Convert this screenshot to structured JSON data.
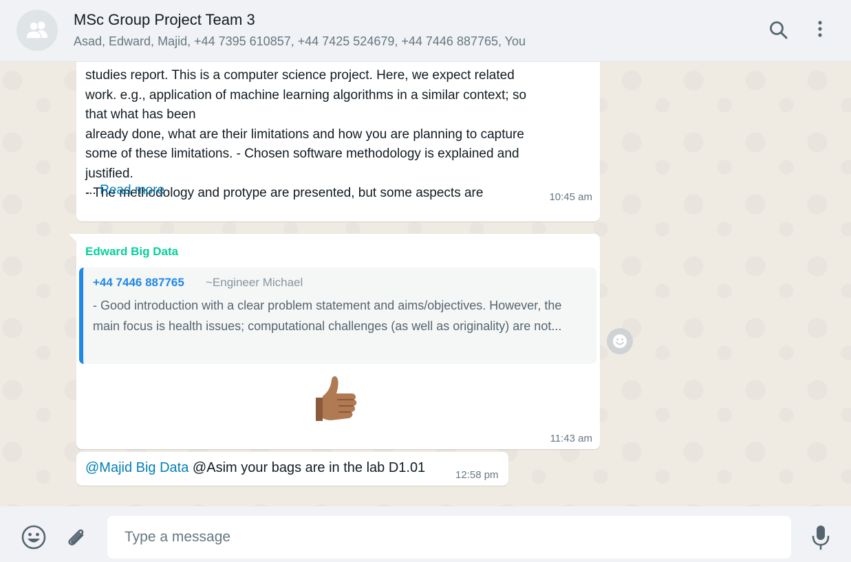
{
  "header": {
    "title": "MSc Group Project Team 3",
    "members": "Asad, Edward, Majid, +44 7395 610857, +44 7425 524679, +44 7446 887765, You",
    "icons": [
      "group-avatar-icon",
      "search-icon",
      "menu-icon"
    ]
  },
  "messages": [
    {
      "text": "studies report. This is a computer science project. Here, we expect related\nwork. e.g., application of machine learning algorithms in a similar context; so\nthat what has been\nalready done, what are their limitations and how you are planning to capture\nsome of these limitations. - Chosen software methodology is explained and\njustified.\n- The methodology and protype are presented, but some aspects are",
      "ellipsis": "... ",
      "read_more": "Read more",
      "time": "10:45 am"
    },
    {
      "sender": "Edward Big Data",
      "quote_author": "+44 7446 887765",
      "quote_alias": "~Engineer Michael",
      "quote_text": "- Good introduction with a clear problem statement and aims/objectives. However, the main focus is health issues; computational challenges (as well as originality) are not...",
      "emoji": "thumbs-up (medium skin tone)",
      "time": "11:43 am"
    },
    {
      "mention": "@Majid Big Data",
      "text": " @Asim your bags are in the lab D1.01",
      "time": "12:58 pm"
    }
  ],
  "footer": {
    "placeholder": "Type a message",
    "icons": [
      "emoji-icon",
      "attach-icon",
      "mic-icon"
    ]
  },
  "colors": {
    "header_bg": "#f0f2f5",
    "chat_bg": "#efeae2",
    "sender_name": "#06cf9c",
    "quote_accent": "#1e88e5",
    "link": "#027eb5"
  }
}
